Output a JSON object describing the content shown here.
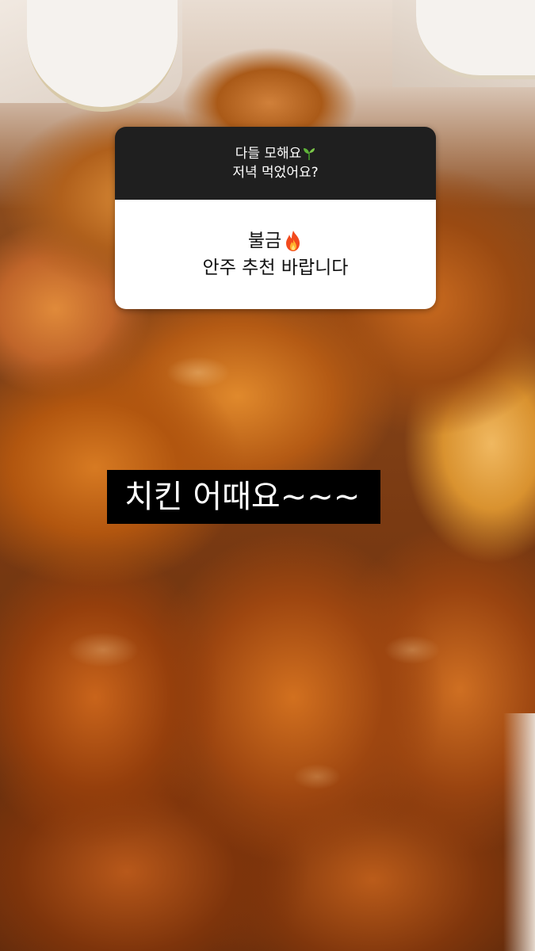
{
  "question_sticker": {
    "header_line1": "다들 모해요",
    "header_line1_emoji": "sprout-icon",
    "header_line2": "저녁 먹었어요?",
    "answer_line1": "불금",
    "answer_line1_emoji": "fire-icon",
    "answer_line2": "안주 추천 바랍니다"
  },
  "caption": {
    "text": "치킨 어때요~~~"
  },
  "colors": {
    "sticker_header_bg": "#1f1f1f",
    "sticker_body_bg": "#ffffff",
    "caption_bg": "#000000",
    "caption_text": "#ffffff"
  }
}
